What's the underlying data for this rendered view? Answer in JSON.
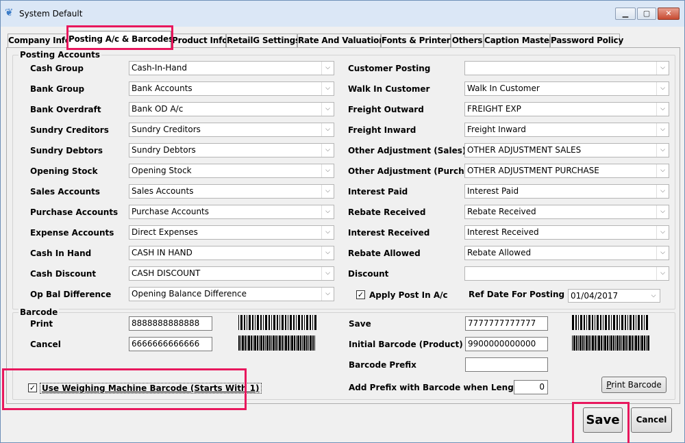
{
  "window": {
    "title": "System Default"
  },
  "tabs": [
    {
      "label": "Company Info"
    },
    {
      "label": "Posting A/c & Barcodes"
    },
    {
      "label": "Product Info"
    },
    {
      "label": "RetailG Settings"
    },
    {
      "label": "Rate And Valuation"
    },
    {
      "label": "Fonts & Printers"
    },
    {
      "label": "Others"
    },
    {
      "label": "Caption Master"
    },
    {
      "label": "Password Policy"
    }
  ],
  "posting": {
    "title": "Posting Accounts",
    "left": [
      {
        "label": "Cash Group",
        "value": "Cash-In-Hand"
      },
      {
        "label": "Bank Group",
        "value": "Bank Accounts"
      },
      {
        "label": "Bank Overdraft",
        "value": "Bank OD A/c"
      },
      {
        "label": "Sundry Creditors",
        "value": "Sundry Creditors"
      },
      {
        "label": "Sundry Debtors",
        "value": "Sundry Debtors"
      },
      {
        "label": "Opening Stock",
        "value": "Opening Stock"
      },
      {
        "label": "Sales Accounts",
        "value": "Sales Accounts"
      },
      {
        "label": "Purchase Accounts",
        "value": "Purchase Accounts"
      },
      {
        "label": "Expense Accounts",
        "value": "Direct Expenses"
      },
      {
        "label": "Cash In Hand",
        "value": "CASH IN HAND"
      },
      {
        "label": "Cash Discount",
        "value": "CASH DISCOUNT"
      },
      {
        "label": "Op Bal Difference",
        "value": "Opening Balance Difference"
      }
    ],
    "right": [
      {
        "label": "Customer Posting",
        "value": ""
      },
      {
        "label": "Walk In Customer",
        "value": "Walk In Customer"
      },
      {
        "label": "Freight Outward",
        "value": "FREIGHT EXP"
      },
      {
        "label": "Freight Inward",
        "value": "Freight Inward"
      },
      {
        "label": "Other Adjustment (Sales)",
        "value": "OTHER ADJUSTMENT SALES"
      },
      {
        "label": "Other Adjustment (Purchase)",
        "value": "OTHER ADJUSTMENT PURCHASE"
      },
      {
        "label": "Interest Paid",
        "value": "Interest Paid"
      },
      {
        "label": "Rebate Received",
        "value": "Rebate Received"
      },
      {
        "label": "Interest Received",
        "value": "Interest Received"
      },
      {
        "label": "Rebate Allowed",
        "value": "Rebate Allowed"
      },
      {
        "label": "Discount",
        "value": ""
      }
    ],
    "apply_post_label": "Apply Post In A/c",
    "apply_post_checked": true,
    "ref_date_label": "Ref Date For Posting",
    "ref_date_value": "01/04/2017"
  },
  "barcode": {
    "title": "Barcode",
    "print_label": "Print",
    "print_value": "8888888888888",
    "cancel_label": "Cancel",
    "cancel_value": "6666666666666",
    "save_label": "Save",
    "save_value": "7777777777777",
    "initial_label": "Initial Barcode (Product)",
    "initial_value": "9900000000000",
    "prefix_label": "Barcode Prefix",
    "prefix_value": "",
    "add_prefix_label": "Add Prefix with Barcode when Length is",
    "add_prefix_value": "0",
    "weighing_label": "Use Weighing Machine Barcode (Starts With 1)",
    "weighing_checked": true,
    "print_barcode_button": "Print Barcode"
  },
  "footer": {
    "save_button": "Save",
    "cancel_button": "Cancel"
  },
  "colors": {
    "highlight": "#e8175d",
    "title_bar": "#dbe7f6"
  },
  "icons": {
    "app": "app-logo-icon",
    "check": "check-icon",
    "arrow": "chevron-down-icon"
  }
}
